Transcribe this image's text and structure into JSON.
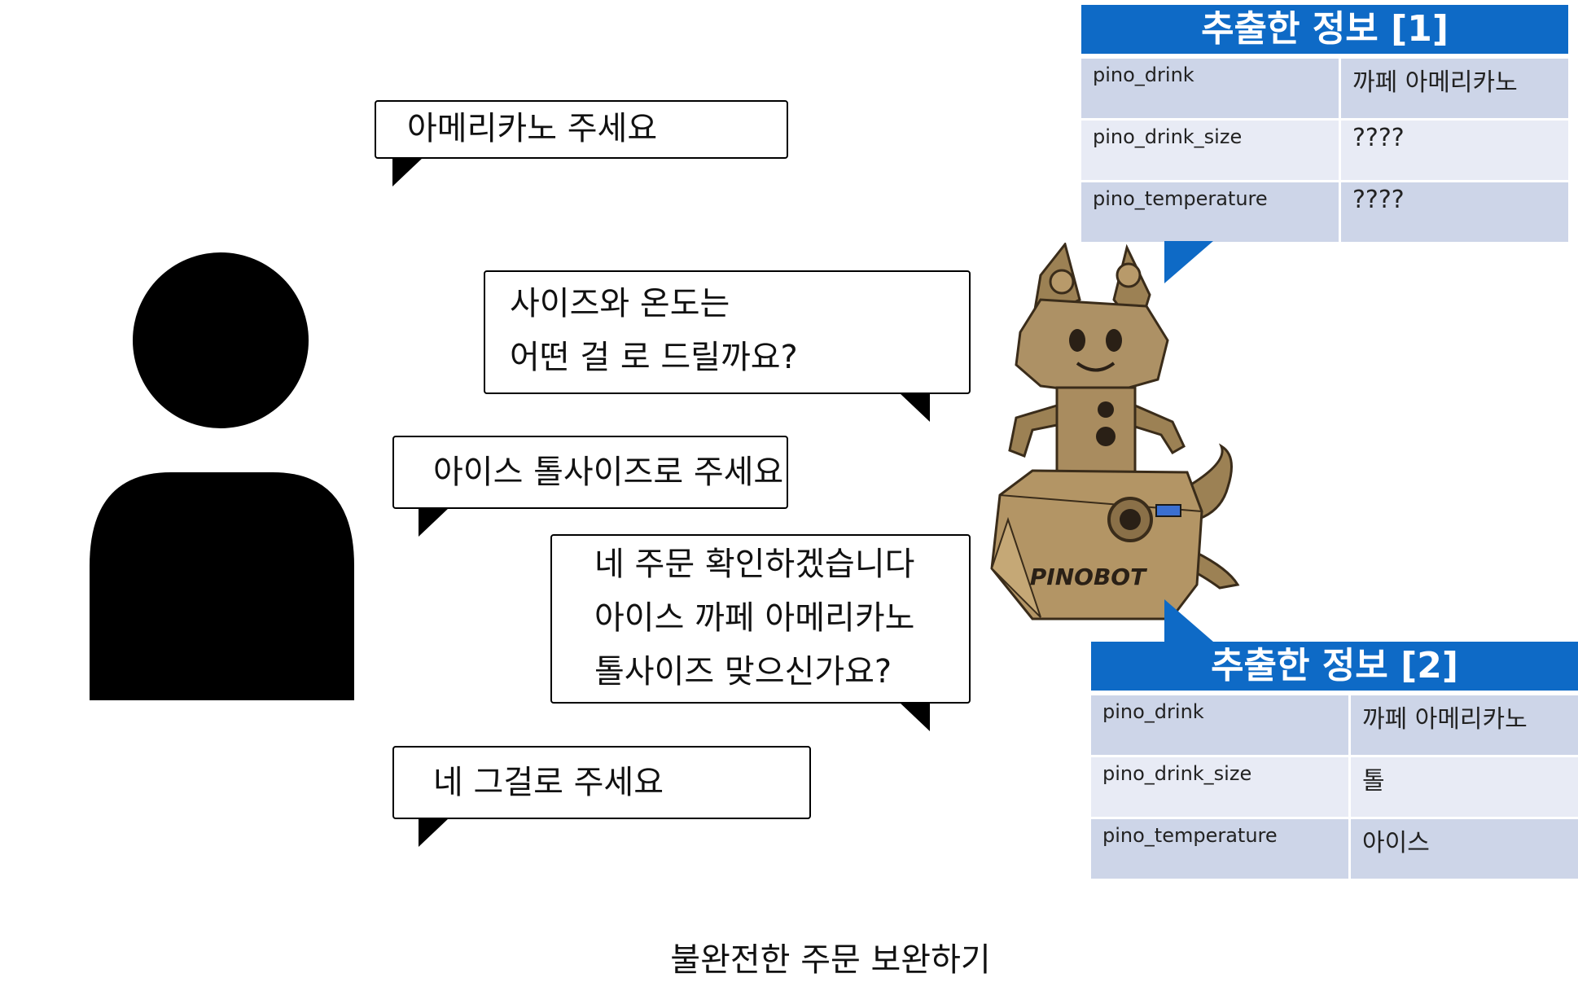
{
  "bubbles": {
    "b1": [
      "아메리카노 주세요"
    ],
    "b2": [
      "사이즈와 온도는",
      "어떤 걸 로 드릴까요?"
    ],
    "b3": [
      "아이스 톨사이즈로 주세요"
    ],
    "b4": [
      "네 주문 확인하겠습니다",
      "아이스 까페 아메리카노",
      "톨사이즈 맞으신가요?"
    ],
    "b5": [
      "네 그걸로 주세요"
    ]
  },
  "robot": {
    "label": "PINOBOT"
  },
  "info1": {
    "title": "추출한 정보 [1]",
    "rows": [
      {
        "key": "pino_drink",
        "value": "까페 아메리카노"
      },
      {
        "key": "pino_drink_size",
        "value": "????"
      },
      {
        "key": "pino_temperature",
        "value": "????"
      }
    ]
  },
  "info2": {
    "title": "추출한 정보 [2]",
    "rows": [
      {
        "key": "pino_drink",
        "value": "까페 아메리카노"
      },
      {
        "key": "pino_drink_size",
        "value": "톨"
      },
      {
        "key": "pino_temperature",
        "value": "아이스"
      }
    ]
  },
  "caption": "불완전한 주문 보완하기",
  "colors": {
    "header_blue": "#0e6ac6",
    "row_dark": "#cdd5e8",
    "row_light": "#e8ebf5",
    "wood": "#a88a5c"
  }
}
